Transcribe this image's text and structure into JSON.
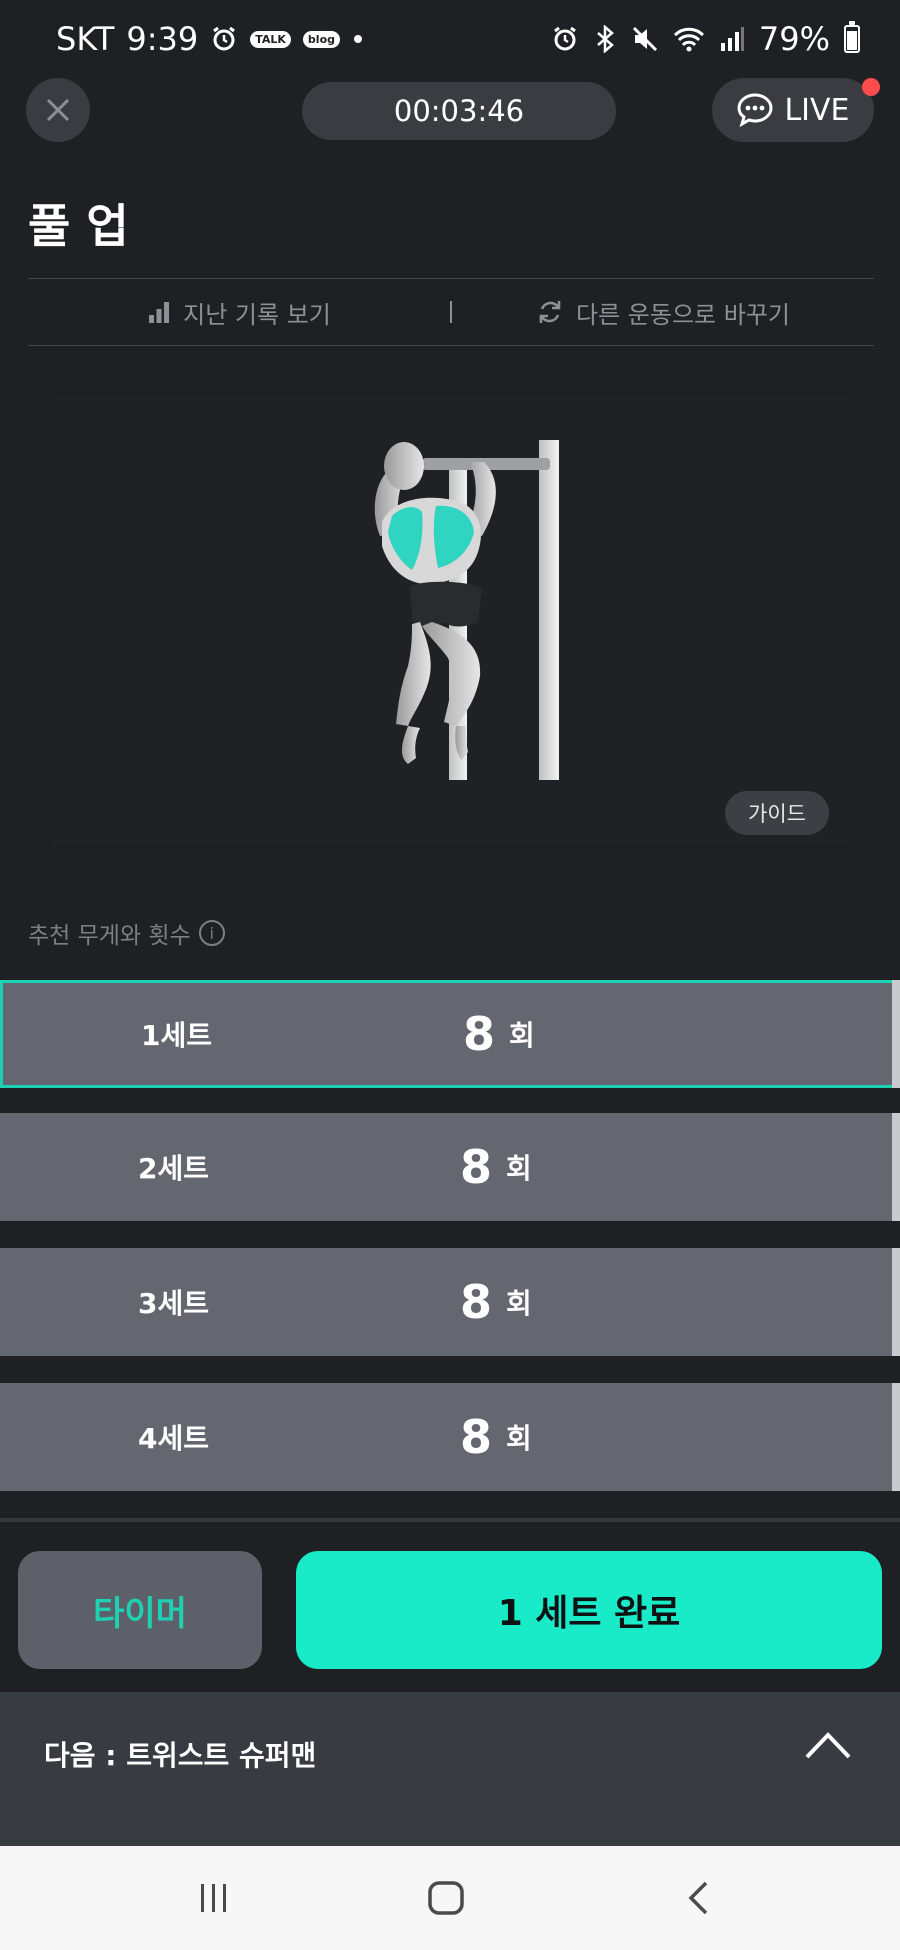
{
  "status_bar": {
    "carrier": "SKT",
    "time": "9:39",
    "talk_badge": "TALK",
    "blog_badge": "blog",
    "battery": "79%",
    "icons": [
      "alarm-icon",
      "talk-icon",
      "blog-icon",
      "alarm-icon",
      "bluetooth-icon",
      "mute-icon",
      "wifi-icon",
      "signal-icon",
      "battery-icon"
    ]
  },
  "header": {
    "elapsed": "00:03:46",
    "live_label": "LIVE"
  },
  "exercise": {
    "title": "풀 업",
    "history_label": "지난 기록 보기",
    "change_label": "다른 운동으로 바꾸기",
    "guide_label": "가이드"
  },
  "recommendation": {
    "label": "추천 무게와 횟수",
    "info_glyph": "i"
  },
  "sets": [
    {
      "label": "1세트",
      "reps": "8",
      "unit": "회"
    },
    {
      "label": "2세트",
      "reps": "8",
      "unit": "회"
    },
    {
      "label": "3세트",
      "reps": "8",
      "unit": "회"
    },
    {
      "label": "4세트",
      "reps": "8",
      "unit": "회"
    }
  ],
  "actions": {
    "timer_label": "타이머",
    "complete_label": "1 세트 완료"
  },
  "next": {
    "label": "다음 : 트위스트 슈퍼맨"
  },
  "colors": {
    "accent": "#19ebc8",
    "background": "#1f2023",
    "row": "#646670",
    "live_dot": "#ff4b4b"
  }
}
